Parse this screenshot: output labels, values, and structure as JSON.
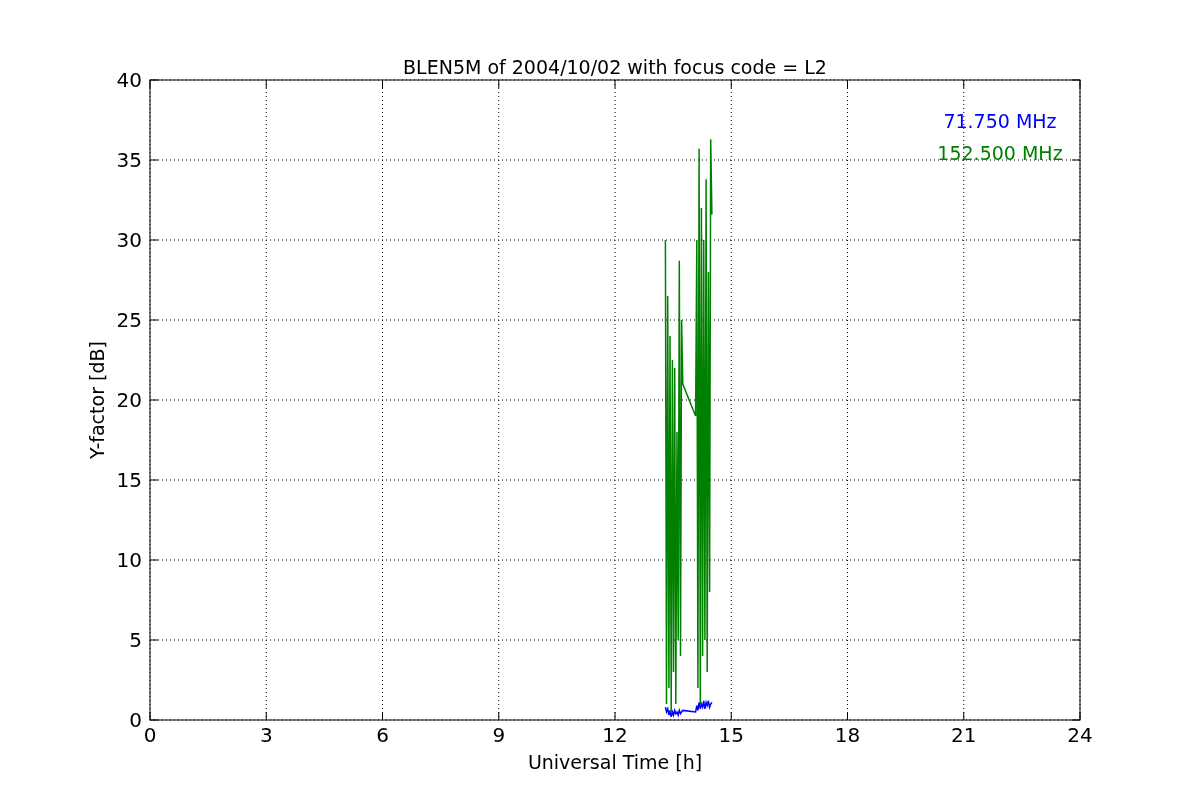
{
  "chart_data": {
    "type": "line",
    "title": "BLEN5M of 2004/10/02 with focus code = L2",
    "xlabel": "Universal Time [h]",
    "ylabel": "Y-factor [dB]",
    "x": [
      13.3,
      13.33,
      13.36,
      13.39,
      13.42,
      13.45,
      13.48,
      13.51,
      13.54,
      13.57,
      13.6,
      13.63,
      13.66,
      13.69,
      13.72,
      13.75,
      14.08,
      14.11,
      14.14,
      14.17,
      14.2,
      14.23,
      14.26,
      14.29,
      14.32,
      14.35,
      14.38,
      14.41,
      14.44,
      14.47,
      14.5
    ],
    "series": [
      {
        "name": "71.750 MHz",
        "color": "#0000ff",
        "values": [
          0.8,
          0.5,
          0.7,
          0.3,
          0.6,
          0.2,
          0.5,
          0.3,
          0.6,
          0.4,
          0.5,
          0.3,
          0.6,
          0.4,
          0.5,
          0.6,
          0.5,
          0.9,
          0.6,
          1.1,
          0.7,
          1.0,
          0.8,
          1.2,
          0.7,
          1.1,
          0.9,
          1.2,
          0.8,
          1.0,
          1.1
        ]
      },
      {
        "name": "152.500 MHz",
        "color": "#008000",
        "values": [
          30,
          1,
          26.5,
          2,
          24,
          0.5,
          22.5,
          3,
          22,
          1,
          18,
          5,
          28.7,
          4,
          25,
          21,
          19,
          30,
          2,
          35.7,
          1,
          32,
          4,
          30,
          5,
          33.8,
          3,
          28,
          8,
          36.3,
          31.6
        ]
      }
    ],
    "xlim": [
      0,
      24
    ],
    "ylim": [
      0,
      40
    ],
    "xticks": [
      0,
      3,
      6,
      9,
      12,
      15,
      18,
      21,
      24
    ],
    "yticks": [
      0,
      5,
      10,
      15,
      20,
      25,
      30,
      35,
      40
    ],
    "grid": true
  }
}
